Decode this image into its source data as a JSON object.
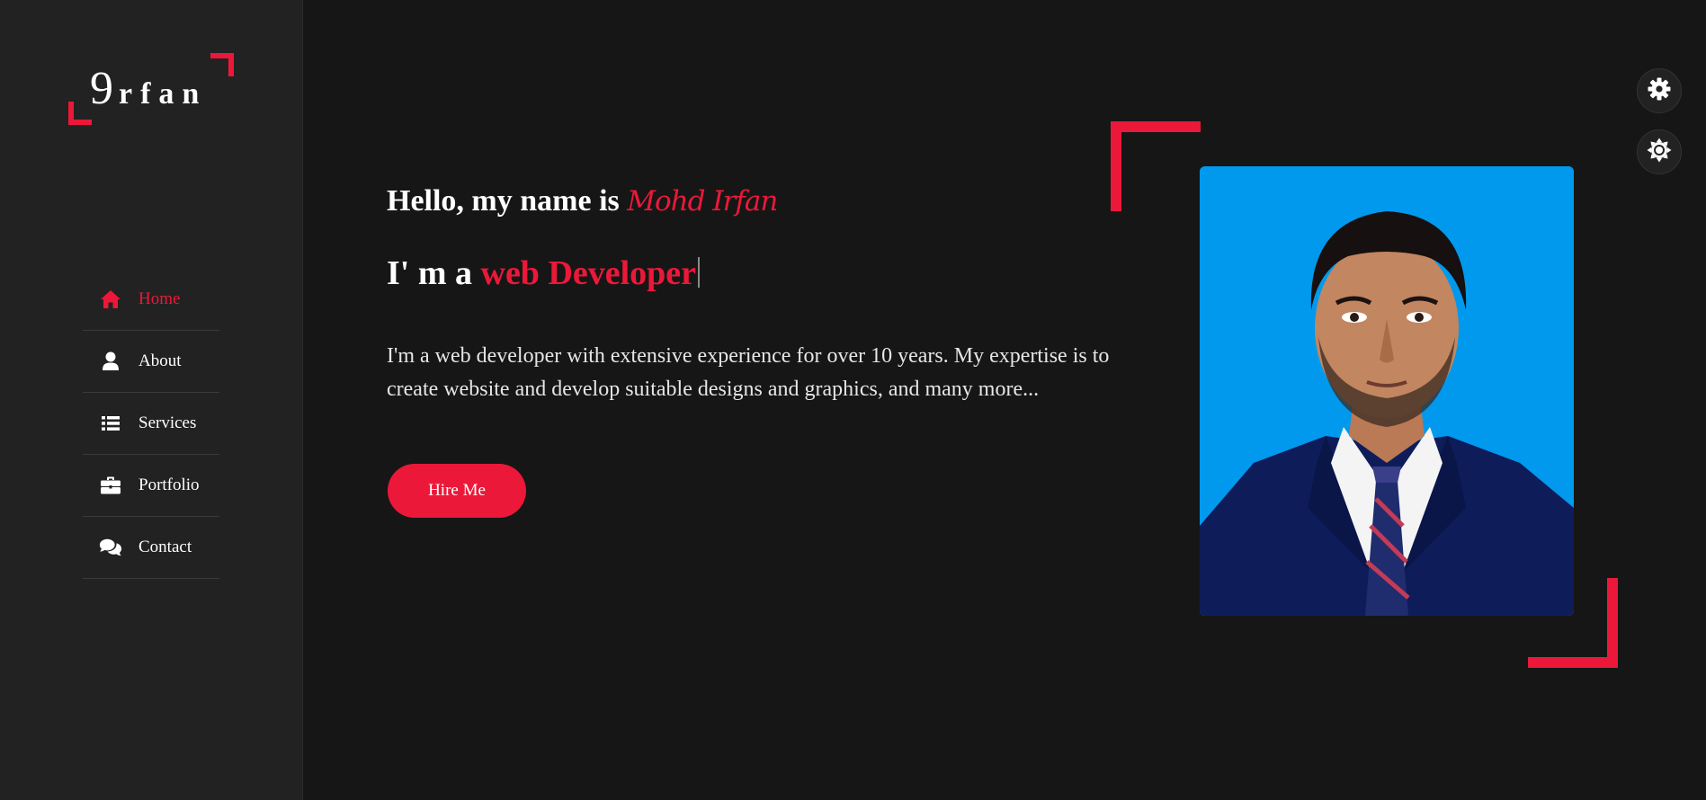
{
  "logo": {
    "first_letter": "9",
    "rest": "rfan"
  },
  "nav": {
    "items": [
      {
        "label": "Home",
        "icon": "home-icon",
        "active": true
      },
      {
        "label": "About",
        "icon": "user-icon",
        "active": false
      },
      {
        "label": "Services",
        "icon": "list-icon",
        "active": false
      },
      {
        "label": "Portfolio",
        "icon": "briefcase-icon",
        "active": false
      },
      {
        "label": "Contact",
        "icon": "comments-icon",
        "active": false
      }
    ]
  },
  "hero": {
    "greeting": "Hello, my name is",
    "name": "Mohd Irfan",
    "role_prefix": "I' m a",
    "role_typed": "web Developer",
    "intro": "I'm a web developer with extensive experience for over 10 years. My expertise is to create website and develop suitable designs and graphics, and many more...",
    "hire_label": "Hire Me"
  },
  "photo": {
    "icon": "profile-photo"
  },
  "floating": {
    "settings_icon": "gear-icon",
    "theme_icon": "sun-icon"
  },
  "colors": {
    "accent": "#ec1839",
    "background": "#161616",
    "sidebar": "#222222",
    "photo_background": "#0099ee",
    "text": "#ffffff"
  }
}
